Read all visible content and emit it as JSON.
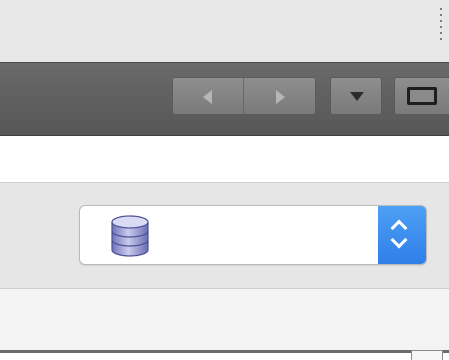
{
  "titlebar": {
    "grip_icon": "vertical-grip-dots"
  },
  "toolbar": {
    "back_icon": "triangle-left",
    "forward_icon": "triangle-right",
    "menu_icon": "triangle-down",
    "window_icon": "window-frame"
  },
  "source_selector": {
    "icon": "database-icon",
    "selected_label": "",
    "stepper_icon": "up-down-chevrons",
    "accent_color": "#3a89ef"
  }
}
